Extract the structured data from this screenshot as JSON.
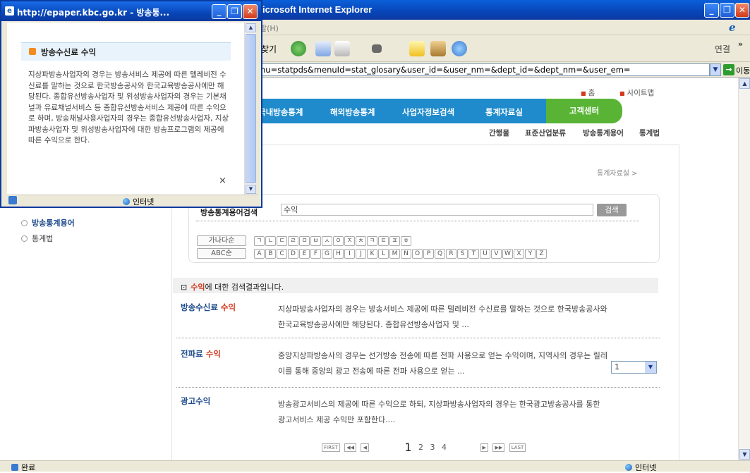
{
  "main_window": {
    "title": "icrosoft Internet Explorer",
    "menu_help": "말(H)",
    "toolbar_search": "찾기",
    "toolbar_links": "연결",
    "toolbar_more": "»",
    "address": "nu=statpds&menuId=stat_glosary&user_id=&user_nm=&dept_id=&dept_nm=&user_em=",
    "go_label": "이동",
    "status_left": "완료",
    "status_zone": "인터넷"
  },
  "site": {
    "util_home": "홈",
    "util_sitemap": "사이트맵",
    "gnb": [
      "국내방송통계",
      "해외방송통계",
      "사업자정보검색",
      "통계자료실"
    ],
    "gnb_active": "고객센터",
    "sub_menu": [
      "간행물",
      "표준산업분류",
      "방송통계용어",
      "통계법"
    ],
    "breadcrumb": "통계자료실 >",
    "side_menu": [
      "방송통계용어",
      "통계법"
    ]
  },
  "search": {
    "label": "방송통계용어검색",
    "value": "수익",
    "button": "검색",
    "index_kor_label": "가나다순",
    "index_kor_keys": [
      "ㄱ",
      "ㄴ",
      "ㄷ",
      "ㄹ",
      "ㅁ",
      "ㅂ",
      "ㅅ",
      "ㅇ",
      "ㅈ",
      "ㅊ",
      "ㅋ",
      "ㅌ",
      "ㅍ",
      "ㅎ"
    ],
    "index_abc_label": "ABC순",
    "index_abc_keys": [
      "A",
      "B",
      "C",
      "D",
      "E",
      "F",
      "G",
      "H",
      "I",
      "J",
      "K",
      "L",
      "M",
      "N",
      "O",
      "P",
      "Q",
      "R",
      "S",
      "T",
      "U",
      "V",
      "W",
      "X",
      "Y",
      "Z"
    ]
  },
  "results": {
    "term": "수익",
    "message_suffix": "에 대한 검색결과입니다.",
    "items": [
      {
        "title_prefix": "방송수신료 ",
        "title_highlight": "수익",
        "desc": "지상파방송사업자의 경우는 방송서비스 제공에 따른 텔레비전 수신료를 말하는 것으로 한국방송공사와 한국교육방송공사에만 해당된다. 종합유선방송사업자 및 ..."
      },
      {
        "title_prefix": "전파료 ",
        "title_highlight": "수익",
        "desc": "중앙지상파방송사의 경우는 선거방송 전송에 따른 전파 사용으로 얻는 수익이며, 지역사의 경우는 릴레이를 통해 중앙의 광고 전송에 따른 전파 사용으로 얻는 ..."
      },
      {
        "title_prefix": "광고수익",
        "title_highlight": "",
        "desc": "방송광고서비스의 제공에 따른 수익으로 하되, 지상파방송사업자의 경우는 한국광고방송공사를 통한 광고서비스 제공 수익만 포함한다...."
      }
    ]
  },
  "pager": {
    "first": "FIRST",
    "prev_block": "◀◀",
    "prev": "◀",
    "pages": [
      "1",
      "2",
      "3",
      "4"
    ],
    "next": "▶",
    "next_block": "▶▶",
    "last": "LAST",
    "select_value": "1"
  },
  "popup": {
    "title": "http://epaper.kbc.go.kr - 방송통...",
    "heading": "방송수신료 수익",
    "body": "지상파방송사업자의 경우는 방송서비스 제공에 따른 텔레비전 수신료를 말하는 것으로 한국방송공사와 한국교육방송공사에만 해당된다. 종합유선방송사업자 및 위성방송사업자의 경우는 기본채널과 유료채널서비스 등 종합유선방송서비스 제공에 따른 수익으로 하며, 방송채널사용사업자의 경우는 종합유선방송사업자, 지상파방송사업자 및 위성방송사업자에 대한 방송프로그램의 제공에 따른 수익으로 한다.",
    "close_x": "×",
    "status_zone": "인터넷"
  }
}
